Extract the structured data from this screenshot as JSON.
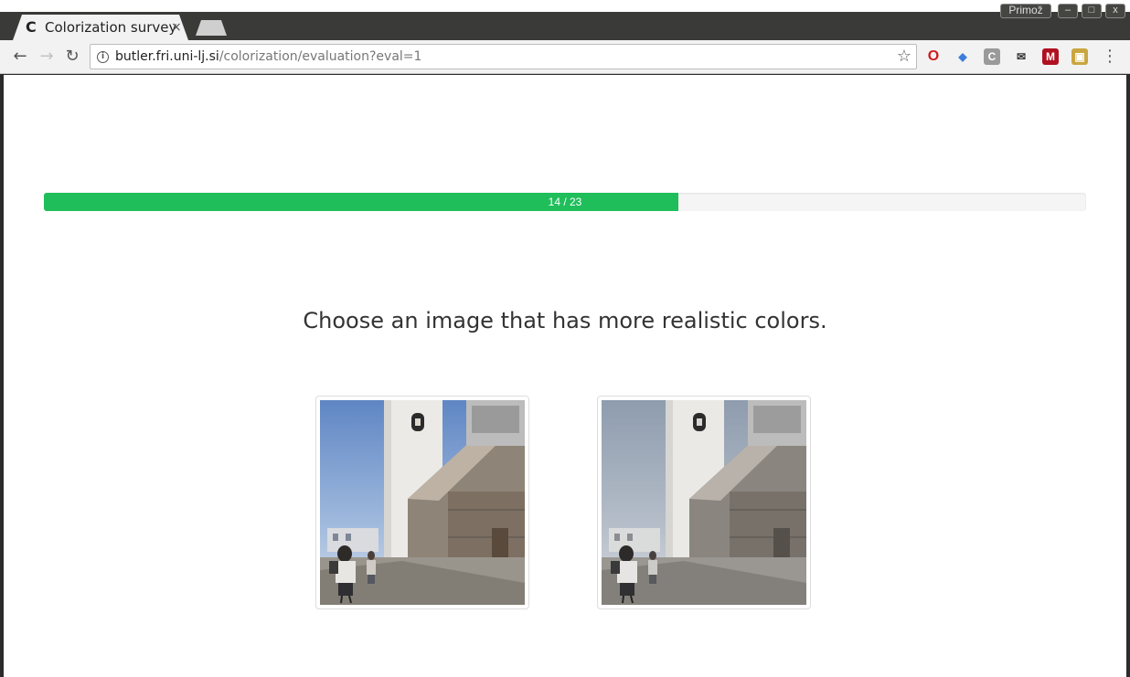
{
  "browser": {
    "tab": {
      "title": "Colorization survey",
      "close": "×",
      "favicon": "C"
    },
    "window": {
      "profile": "Primož",
      "minimize": "–",
      "maximize": "□",
      "close": "x"
    },
    "toolbar": {
      "back": "←",
      "forward": "→",
      "reload": "↻",
      "url_host": "butler.fri.uni-lj.si",
      "url_path": "/colorization/evaluation?eval=1",
      "info": "i",
      "star": "☆",
      "menu": "⋮"
    },
    "extensions": [
      {
        "name": "opera-icon",
        "glyph": "O",
        "color": "#d11a1a"
      },
      {
        "name": "gem-icon",
        "glyph": "◆",
        "color": "#3b7ddd"
      },
      {
        "name": "c-icon",
        "glyph": "C",
        "color": "#9a9a9a"
      },
      {
        "name": "mail-icon",
        "glyph": "✉",
        "color": "#333333"
      },
      {
        "name": "m-icon",
        "glyph": "M",
        "color": "#b01020"
      },
      {
        "name": "photo-icon",
        "glyph": "▣",
        "color": "#c9a640"
      }
    ]
  },
  "survey": {
    "progress": {
      "current": 14,
      "total": 23,
      "label": "14 / 23",
      "fraction": 0.6087
    },
    "question": "Choose an image that has more realistic colors.",
    "choices": [
      {
        "id": "image-a",
        "saturation": "vivid"
      },
      {
        "id": "image-b",
        "saturation": "muted"
      }
    ]
  },
  "colors": {
    "progress_fill": "#1fbe5a",
    "progress_track": "#f5f5f5"
  }
}
